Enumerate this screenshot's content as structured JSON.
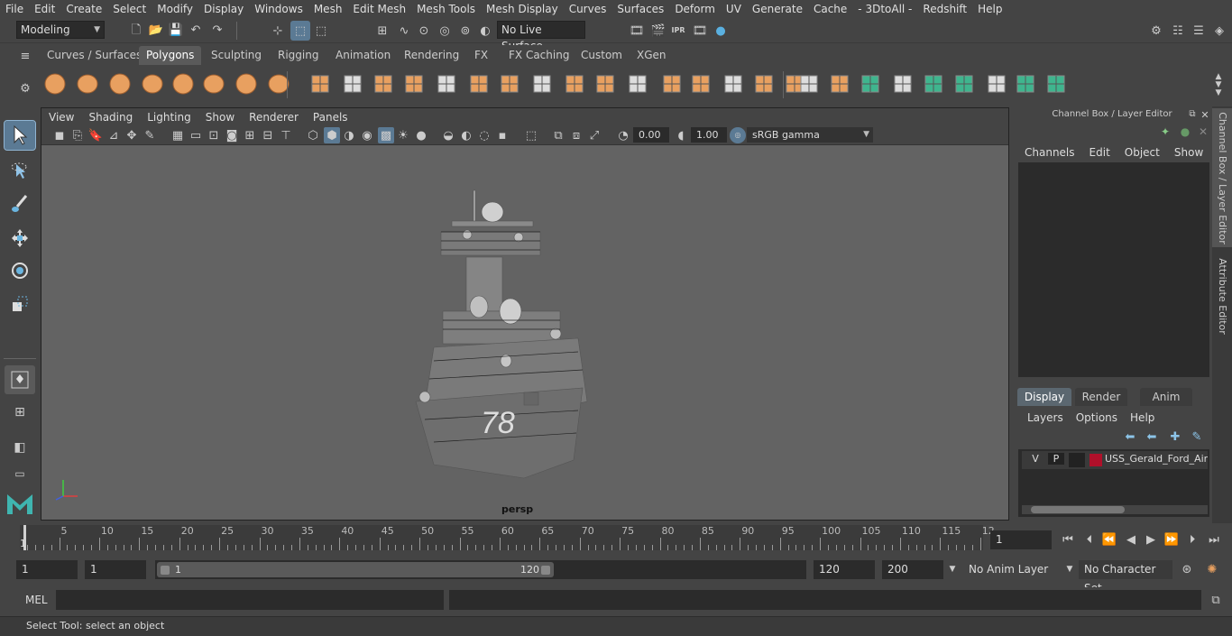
{
  "menubar": [
    "File",
    "Edit",
    "Create",
    "Select",
    "Modify",
    "Display",
    "Windows",
    "Mesh",
    "Edit Mesh",
    "Mesh Tools",
    "Mesh Display",
    "Curves",
    "Surfaces",
    "Deform",
    "UV",
    "Generate",
    "Cache",
    "- 3DtoAll -",
    "Redshift",
    "Help"
  ],
  "status": {
    "mode": "Modeling",
    "live_surface": "No Live Surface"
  },
  "shelf_tabs": [
    "Curves / Surfaces",
    "Polygons",
    "Sculpting",
    "Rigging",
    "Animation",
    "Rendering",
    "FX",
    "FX Caching",
    "Custom",
    "XGen"
  ],
  "shelf_active": "Polygons",
  "viewport": {
    "menu": [
      "View",
      "Shading",
      "Lighting",
      "Show",
      "Renderer",
      "Panels"
    ],
    "exposure": "0.00",
    "gamma": "1.00",
    "colorspace": "sRGB gamma",
    "camera": "persp",
    "hull_number": "78"
  },
  "channel_box": {
    "title": "Channel Box / Layer Editor",
    "menu": [
      "Channels",
      "Edit",
      "Object",
      "Show"
    ],
    "tabs": [
      "Display",
      "Render",
      "Anim"
    ],
    "layer_menu": [
      "Layers",
      "Options",
      "Help"
    ],
    "layer": {
      "v": "V",
      "p": "P",
      "name": "USS_Gerald_Ford_Aircraft",
      "color": "#b0102a"
    }
  },
  "side_tabs": [
    "Channel Box / Layer Editor",
    "Attribute Editor"
  ],
  "timeline": {
    "ticks": [
      "5",
      "10",
      "15",
      "20",
      "25",
      "30",
      "35",
      "40",
      "45",
      "50",
      "55",
      "60",
      "65",
      "70",
      "75",
      "80",
      "85",
      "90",
      "95",
      "100",
      "105",
      "110",
      "115",
      "12"
    ],
    "start_marker": "1",
    "current_frame": "1"
  },
  "range": {
    "start": "1",
    "playback_start": "1",
    "slider_start": "1",
    "slider_end": "120",
    "playback_end": "120",
    "end": "200",
    "anim_layer": "No Anim Layer",
    "char_set": "No Character Set"
  },
  "mel": {
    "label": "MEL"
  },
  "help_line": "Select Tool: select an object",
  "colors": {
    "accent": "#5b7a94",
    "shelf_icon": "#e8a060",
    "shelf_icon_green": "#3fb58e"
  }
}
